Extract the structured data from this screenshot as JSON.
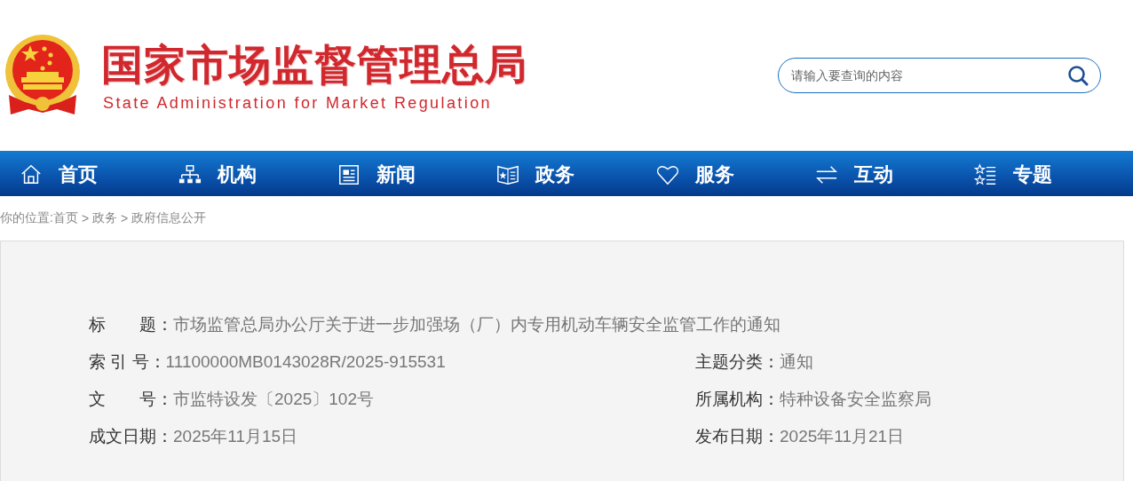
{
  "header": {
    "title": "国家市场监督管理总局",
    "subtitle": "State Administration for Market Regulation",
    "search": {
      "placeholder": "请输入要查询的内容"
    }
  },
  "nav": [
    {
      "label": "首页"
    },
    {
      "label": "机构"
    },
    {
      "label": "新闻"
    },
    {
      "label": "政务"
    },
    {
      "label": "服务"
    },
    {
      "label": "互动"
    },
    {
      "label": "专题"
    }
  ],
  "breadcrumb": [
    {
      "text": "你的位置:",
      "kind": "label"
    },
    {
      "text": "首页",
      "kind": "link"
    },
    {
      "text": ">",
      "kind": "separator"
    },
    {
      "text": "政务",
      "kind": "link"
    },
    {
      "text": ">",
      "kind": "separator"
    },
    {
      "text": "政府信息公开",
      "kind": "link"
    }
  ],
  "info_rows": [
    {
      "cells": [
        {
          "label": "标　　题：",
          "value": "市场监管总局办公厅关于进一步加强场（厂）内专用机动车辆安全监管工作的通知"
        }
      ]
    },
    {
      "cells": [
        {
          "label": "索 引 号：",
          "value": "11100000MB0143028R/2025-915531"
        },
        {
          "label": "主题分类：",
          "value": "通知"
        }
      ]
    },
    {
      "cells": [
        {
          "label": "文　　号：",
          "value": "市监特设发〔2025〕102号"
        },
        {
          "label": "所属机构：",
          "value": "特种设备安全监察局"
        }
      ]
    },
    {
      "cells": [
        {
          "label": "成文日期：",
          "value": "2025年11月15日"
        },
        {
          "label": "发布日期：",
          "value": "2025年11月21日"
        }
      ]
    }
  ]
}
